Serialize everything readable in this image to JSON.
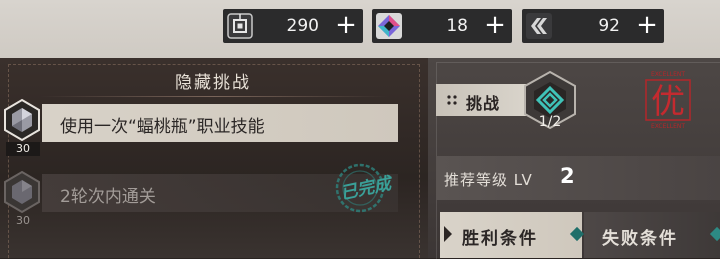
{
  "currencies": [
    {
      "icon": "circuit-chip-icon",
      "value": "290",
      "add": "+"
    },
    {
      "icon": "prism-crystal-icon",
      "value": "18",
      "add": "+"
    },
    {
      "icon": "chevron-stack-icon",
      "value": "92",
      "add": "+"
    }
  ],
  "hidden_challenge": {
    "title": "隐藏挑战",
    "tasks": [
      {
        "label": "使用一次“蝠桃瓶”职业技能",
        "reward": "30",
        "state": "active"
      },
      {
        "label": "2轮次内通关",
        "reward": "30",
        "state": "completed"
      }
    ],
    "completed_stamp": "已完成"
  },
  "challenge": {
    "label": "挑战",
    "progress": "1/2",
    "rank_char": "优",
    "rank_text": "EXCELLENT"
  },
  "recommend": {
    "label": "推荐等级 LV",
    "level": "2"
  },
  "tabs": {
    "win": "胜利条件",
    "lose": "失败条件"
  },
  "colors": {
    "accent_teal": "#2d8a84",
    "rank_red": "#b3262a",
    "panel_light": "#d9d3c9"
  }
}
